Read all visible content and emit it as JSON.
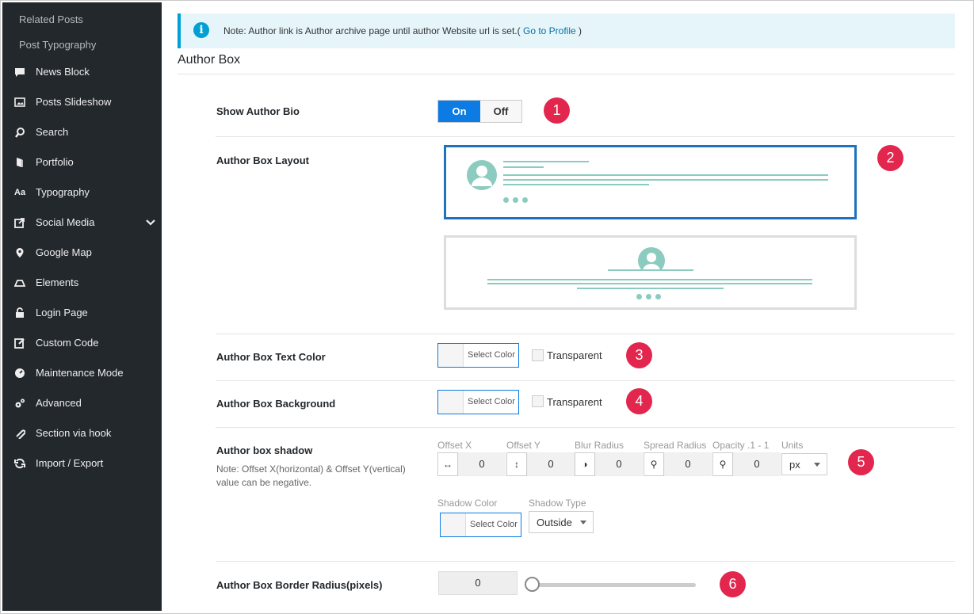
{
  "sidebar": {
    "sub_items": [
      {
        "label": "Related Posts"
      },
      {
        "label": "Post Typography"
      }
    ],
    "items": [
      {
        "label": "News Block",
        "icon": "comment-icon"
      },
      {
        "label": "Posts Slideshow",
        "icon": "image-icon"
      },
      {
        "label": "Search",
        "icon": "search-icon"
      },
      {
        "label": "Portfolio",
        "icon": "portfolio-icon"
      },
      {
        "label": "Typography",
        "icon": "typography-icon"
      },
      {
        "label": "Social Media",
        "icon": "share-icon"
      },
      {
        "label": "Google Map",
        "icon": "map-pin-icon"
      },
      {
        "label": "Elements",
        "icon": "elements-icon"
      },
      {
        "label": "Login Page",
        "icon": "lock-icon"
      },
      {
        "label": "Custom Code",
        "icon": "edit-icon"
      },
      {
        "label": "Maintenance Mode",
        "icon": "gauge-icon"
      },
      {
        "label": "Advanced",
        "icon": "gears-icon"
      },
      {
        "label": "Section via hook",
        "icon": "paperclip-icon"
      },
      {
        "label": "Import / Export",
        "icon": "refresh-icon"
      }
    ]
  },
  "notice": {
    "text": "Note: Author link is Author archive page until author Website url is set.(",
    "link": "Go to Profile",
    "suffix": ")"
  },
  "section_title": "Author Box",
  "rows": {
    "show_author_bio": {
      "label": "Show Author Bio",
      "on": "On",
      "off": "Off",
      "value": "On"
    },
    "layout": {
      "label": "Author Box Layout",
      "selected": 1
    },
    "text_color": {
      "label": "Author Box Text Color",
      "button": "Select Color",
      "transparent": "Transparent"
    },
    "background": {
      "label": "Author Box Background",
      "button": "Select Color",
      "transparent": "Transparent"
    },
    "shadow": {
      "label": "Author box shadow",
      "note": "Note: Offset X(horizontal) & Offset Y(vertical) value can be negative.",
      "fields": [
        {
          "caption": "Offset X",
          "value": "0",
          "icon": "horizontal-arrows-icon"
        },
        {
          "caption": "Offset Y",
          "value": "0",
          "icon": "vertical-arrows-icon"
        },
        {
          "caption": "Blur Radius",
          "value": "0",
          "icon": "contrast-icon"
        },
        {
          "caption": "Spread Radius",
          "value": "0",
          "icon": "lightbulb-icon"
        },
        {
          "caption": "Opacity .1 - 1",
          "value": "0",
          "icon": "lightbulb-icon"
        }
      ],
      "units_caption": "Units",
      "units_value": "px",
      "color_caption": "Shadow Color",
      "color_button": "Select Color",
      "type_caption": "Shadow Type",
      "type_value": "Outside"
    },
    "border_radius": {
      "label": "Author Box Border Radius(pixels)",
      "value": "0",
      "slider_fraction": 0
    }
  },
  "badges": [
    "1",
    "2",
    "3",
    "4",
    "5",
    "6"
  ],
  "colors": {
    "accent": "#0c7be3",
    "badge": "#e2264d",
    "sidebar": "#23282d",
    "layout_line": "#8ccbbf"
  }
}
